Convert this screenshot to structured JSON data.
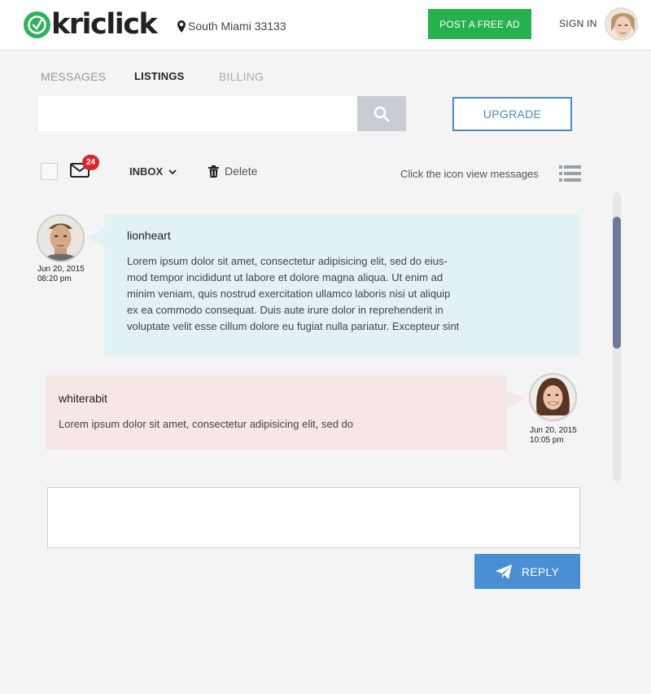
{
  "header": {
    "logo_text": "kriclick",
    "location": "South Miami 33133",
    "post_ad_label": "POST A FREE AD",
    "sign_in_label": "SIGN IN"
  },
  "tabs": [
    {
      "label": "MESSAGES",
      "active": false
    },
    {
      "label": "LISTINGS",
      "active": true
    },
    {
      "label": "BILLING",
      "active": false
    }
  ],
  "search": {
    "placeholder": "",
    "value": ""
  },
  "upgrade_label": "UPGRADE",
  "toolbar": {
    "unread_count": "24",
    "inbox_label": "INBOX",
    "delete_label": "Delete",
    "hint": "Click the icon view messages"
  },
  "messages": [
    {
      "sender": "lionheart",
      "date": "Jun 20, 2015",
      "time": "08:20 pm",
      "lines": [
        "Lorem ipsum dolor sit amet, consectetur adipisicing elit, sed do eius-",
        "mod tempor incididunt ut labore et dolore magna aliqua. Ut enim ad",
        "minim veniam, quis nostrud exercitation ullamco laboris nisi ut aliquip",
        "ex ea commodo consequat. Duis aute irure dolor in reprehenderit in",
        "voluptate velit esse cillum dolore eu fugiat nulla pariatur. Excepteur sint"
      ]
    },
    {
      "sender": "whiterabit",
      "date": "Jun 20, 2015",
      "time": "10:05 pm",
      "lines": [
        "Lorem ipsum dolor sit amet, consectetur adipisicing elit, sed do"
      ]
    }
  ],
  "reply": {
    "placeholder": "",
    "button_label": "REPLY"
  },
  "colors": {
    "brand_green": "#27b04e",
    "accent_blue": "#4a89c8",
    "badge_red": "#d52a2a",
    "incoming_bubble": "#e2f1f4",
    "outgoing_bubble": "#f6e6e6",
    "scroll_thumb": "#6f7a94"
  },
  "icons": [
    "map-marker-icon",
    "search-icon",
    "mail-icon",
    "chevron-down-icon",
    "trash-icon",
    "list-icon",
    "paper-plane-icon"
  ]
}
